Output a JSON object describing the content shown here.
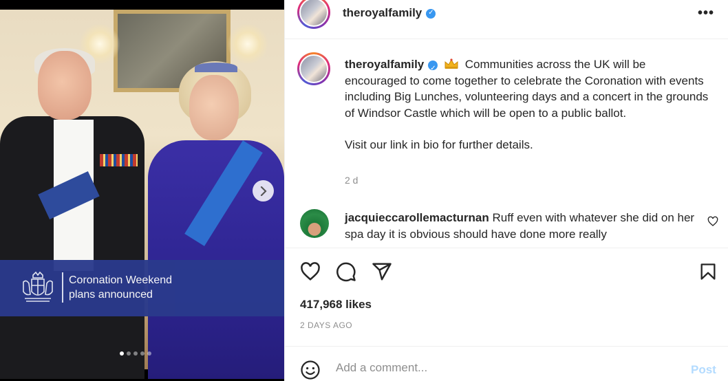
{
  "media": {
    "banner_line1": "Coronation Weekend",
    "banner_line2": "plans announced",
    "carousel_dots": 5,
    "active_dot": 0
  },
  "header": {
    "username": "theroyalfamily",
    "verified": true,
    "more_icon": "more-horizontal-icon"
  },
  "caption": {
    "username": "theroyalfamily",
    "emoji": "crown",
    "text": "Communities across the UK will be encouraged to come together to celebrate the Coronation with events including Big Lunches, volunteering days and a concert in the grounds of Windsor Castle which will be open to a public ballot.",
    "text2": "Visit our link in bio for further details.",
    "time": "2 d"
  },
  "comments": [
    {
      "username": "jacquieccarollemacturnan",
      "text": "Ruff even with whatever she did on her spa day it is obvious should have done more really"
    }
  ],
  "actions": {
    "like_icon": "heart-icon",
    "comment_icon": "comment-icon",
    "share_icon": "send-icon",
    "save_icon": "bookmark-icon"
  },
  "likes": "417,968 likes",
  "posted_ago": "2 DAYS AGO",
  "add_comment": {
    "placeholder": "Add a comment...",
    "post_label": "Post"
  },
  "colors": {
    "banner_blue": "#2a3a8c",
    "verified_blue": "#3897f0",
    "post_button_disabled": "#b3dbff",
    "muted_text": "#8e8e8e"
  }
}
